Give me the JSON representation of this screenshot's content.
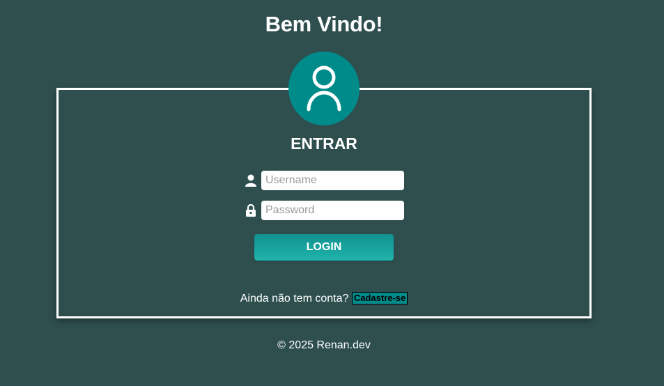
{
  "header": {
    "title": "Bem Vindo!"
  },
  "login_form": {
    "avatar_icon": "user-avatar-icon",
    "title": "ENTRAR",
    "username": {
      "icon": "user-icon",
      "placeholder": "Username",
      "value": ""
    },
    "password": {
      "icon": "lock-icon",
      "placeholder": "Password",
      "value": ""
    },
    "submit_label": "LOGIN",
    "signup_prompt": "Ainda não tem conta?",
    "signup_link": "Cadastre-se"
  },
  "footer": {
    "text": "© 2025 Renan.dev"
  },
  "colors": {
    "background": "#2f4f4f",
    "accent": "#008b8b",
    "button": "#1fb3ab",
    "text": "#ffffff"
  }
}
